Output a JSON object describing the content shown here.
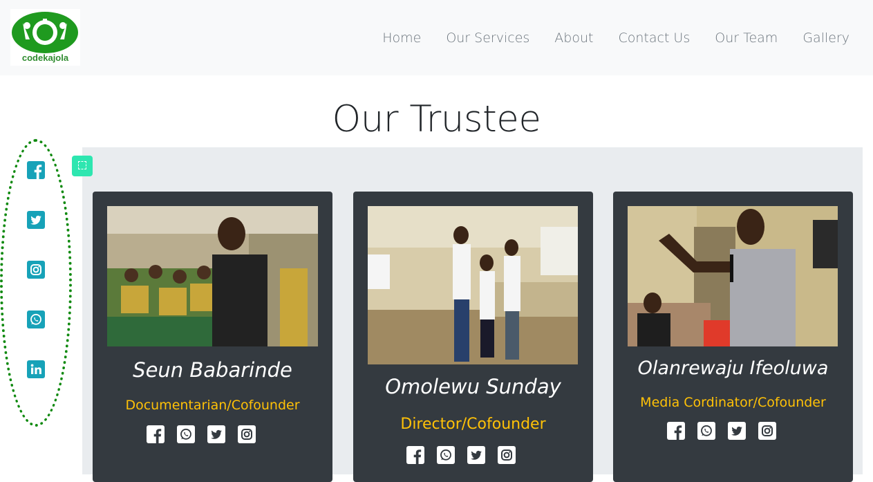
{
  "brand": {
    "logo_text": "codekajola"
  },
  "nav": {
    "items": [
      "Home",
      "Our Services",
      "About",
      "Contact Us",
      "Our Team",
      "Gallery"
    ]
  },
  "page": {
    "title": "Our Trustee"
  },
  "sidebar_social": [
    "facebook-icon",
    "twitter-icon",
    "instagram-icon",
    "whatsapp-icon",
    "linkedin-icon"
  ],
  "trustees": [
    {
      "name": "Seun Babarinde",
      "role": "Documentarian/Cofounder"
    },
    {
      "name": "Omolewu Sunday",
      "role": "Director/Cofounder"
    },
    {
      "name": "Olanrewaju Ifeoluwa",
      "role": "Media Cordinator/Cofounder"
    }
  ],
  "colors": {
    "navbar_bg": "#f8f9fa",
    "card_bg": "#343a40",
    "role": "#ffc107",
    "rail_icon": "#17a2b8",
    "rail_border": "#118a11",
    "section_bg": "#e9ecef"
  }
}
